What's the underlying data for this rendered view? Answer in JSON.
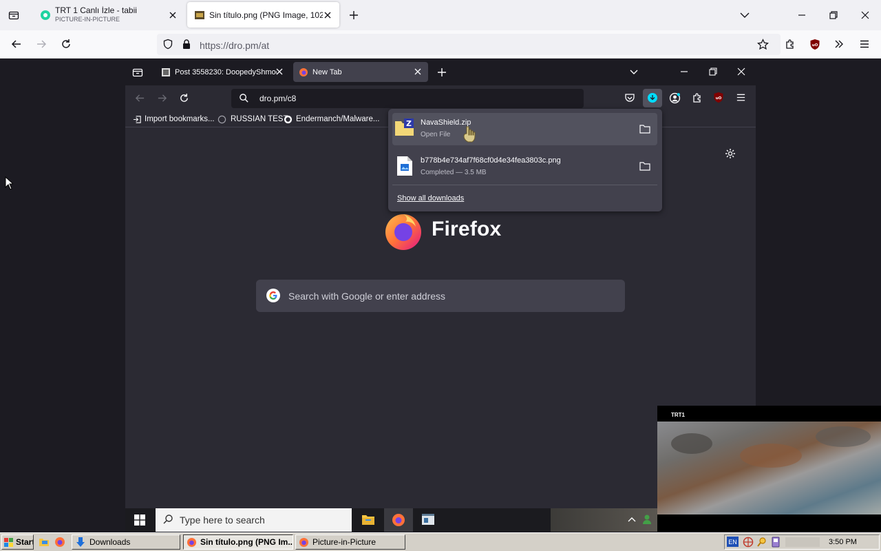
{
  "outer": {
    "tabs": [
      {
        "title": "TRT 1 Canlı İzle - tabii",
        "subtitle": "PICTURE-IN-PICTURE"
      },
      {
        "title": "Sin título.png (PNG Image, 102"
      }
    ],
    "url": "https://dro.pm/at"
  },
  "inner": {
    "tabs": [
      {
        "title": "Post 3558230: DoopedyShmoop"
      },
      {
        "title": "New Tab"
      }
    ],
    "url": "dro.pm/c8",
    "bookmarks": [
      "Import bookmarks...",
      "RUSSIAN TEST",
      "Endermanch/Malware..."
    ],
    "downloads": {
      "items": [
        {
          "name": "NavaShield.zip",
          "status": "Open File"
        },
        {
          "name": "b778b4e734af7f68cf0d4e34fea3803c.png",
          "status": "Completed — 3.5 MB"
        }
      ],
      "show_all": "Show all downloads"
    },
    "newtab": {
      "brand": "Firefox",
      "search_placeholder": "Search with Google or enter address"
    }
  },
  "win10": {
    "search_placeholder": "Type here to search"
  },
  "pip": {
    "channel": "TRT1"
  },
  "xp": {
    "start": "Start",
    "buttons": [
      "Downloads",
      "Sin título.png (PNG Im...",
      "Picture-in-Picture"
    ],
    "lang": "EN",
    "clock": "3:50 PM"
  },
  "colors": {
    "accent_cyan": "#00ddff",
    "ublock_red": "#800000",
    "firefox_orange": "#ff7139",
    "firefox_purple": "#7542e5"
  }
}
